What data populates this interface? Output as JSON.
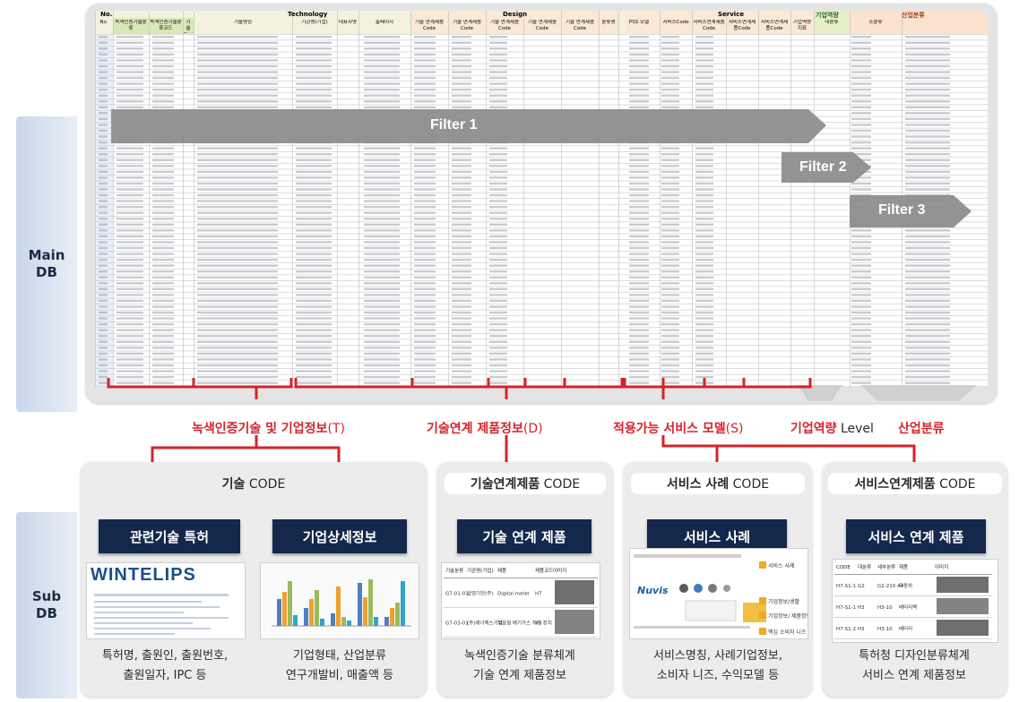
{
  "side_labels": {
    "main": "Main\nDB",
    "sub": "Sub\nDB"
  },
  "sheet": {
    "group_headers": [
      "No.",
      "Technology",
      "Design",
      "Service",
      "기업역량",
      "산업분류"
    ],
    "column_headers": [
      "No.",
      "녹색인증기술분류",
      "녹색인증기술분류코드",
      "기술Code",
      "기술명칭",
      "기관명(기업)",
      "대표자명",
      "홈페이지",
      "기술 연계제품Code",
      "기술 연계제품Code",
      "기술 연계제품Code",
      "기술 연계제품Code",
      "기술 연계제품Code",
      "분류명",
      "PSS 모델",
      "서비스Code",
      "서비스연계제품Code",
      "서비스연계제품Code",
      "서비스연계제품Code",
      "기업역량지표",
      "대분류",
      "소분류"
    ],
    "filters": [
      "Filter 1",
      "Filter 2",
      "Filter 3"
    ]
  },
  "categories": [
    {
      "main": "녹색인증기술 및 기업정보",
      "suffix": "(T)"
    },
    {
      "main": "기술연계 제품정보",
      "suffix": "(D)"
    },
    {
      "main": "적용가능 서비스 모델",
      "suffix": "(S)"
    },
    {
      "main": "기업역량",
      "suffix": " Level"
    },
    {
      "main": "산업분류",
      "suffix": ""
    }
  ],
  "panels": [
    {
      "title_bold": "기술",
      "title_plain": " CODE"
    },
    {
      "title_bold": "기술연계제품",
      "title_plain": " CODE"
    },
    {
      "title_bold": "서비스 사례",
      "title_plain": " CODE"
    },
    {
      "title_bold": "서비스연계제품",
      "title_plain": " CODE"
    }
  ],
  "sub_db": [
    {
      "label": "관련기술 특허",
      "desc": "특허명, 출원인, 출원번호,\n출원일자, IPC 등"
    },
    {
      "label": "기업상세정보",
      "desc": "기업형태, 산업분류\n연구개발비, 매출액 등"
    },
    {
      "label": "기술 연계 제품",
      "desc": "녹색인증기술 분류체계\n기술 연계 제품정보"
    },
    {
      "label": "서비스 사례",
      "desc": "서비스명칭, 사례기업정보,\n소비자 니즈, 수익모델 등"
    },
    {
      "label": "서비스 연계 제품",
      "desc": "특허청 디자인분류체계\n서비스 연계 제품정보"
    }
  ],
  "thumbs": {
    "patent_logo": "WINTELIPS",
    "tech_table_headers": [
      "기술분류",
      "기관명(기업)",
      "제품",
      "제품코드",
      "이미지"
    ],
    "tech_table_rows": [
      [
        "G7-01-01",
        "삼영기전(주)",
        "Digital meter",
        "H7"
      ],
      [
        "G7-03-01",
        "(주)에너팩스기업",
        "적응형 배기가스 처리 장치",
        "K9"
      ]
    ],
    "service_brand": "Nuvis",
    "service_labels": [
      "서비스 사례",
      "기업정보/생활",
      "기업정보/ 제품정보",
      "핵심 소비자 니즈"
    ],
    "svc_table_headers": [
      "CODE",
      "대분류",
      "세부분류",
      "제품",
      "이미지"
    ],
    "svc_table_rows": [
      [
        "H7-S1-1",
        "G2",
        "G2-210 A4",
        "자동차"
      ],
      [
        "H7-S1-1",
        "H3",
        "H3-10",
        "배터리팩"
      ],
      [
        "H7-S1-2",
        "H3",
        "H3-10",
        "배터리"
      ]
    ]
  },
  "colors": {
    "red": "#d5232a",
    "navy": "#14284b",
    "filter_gray": "#8a8a8a"
  }
}
